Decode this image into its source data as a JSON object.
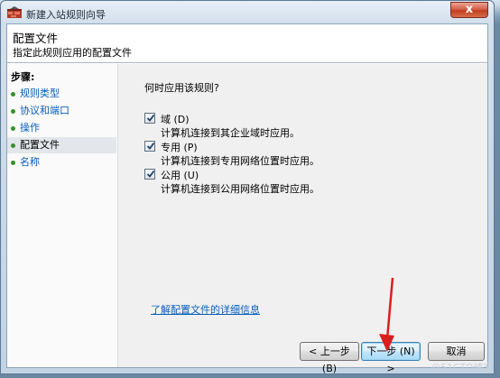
{
  "window": {
    "title": "新建入站规则向导",
    "close_label": "x"
  },
  "header": {
    "title": "配置文件",
    "subtitle": "指定此规则应用的配置文件"
  },
  "steps": {
    "title": "步骤:",
    "items": [
      {
        "label": "规则类型",
        "state": "link"
      },
      {
        "label": "协议和端口",
        "state": "link"
      },
      {
        "label": "操作",
        "state": "link"
      },
      {
        "label": "配置文件",
        "state": "current"
      },
      {
        "label": "名称",
        "state": "link"
      }
    ]
  },
  "main": {
    "question": "何时应用该规则?",
    "options": [
      {
        "label": "域 (D)",
        "description": "计算机连接到其企业域时应用。",
        "checked": true
      },
      {
        "label": "专用 (P)",
        "description": "计算机连接到专用网络位置时应用。",
        "checked": true
      },
      {
        "label": "公用 (U)",
        "description": "计算机连接到公用网络位置时应用。",
        "checked": true
      }
    ],
    "info_link": "了解配置文件的详细信息"
  },
  "buttons": {
    "back": "< 上一步 (B)",
    "next": "下一步 (N) >",
    "cancel": "取消"
  },
  "watermark": "@51CTO博客",
  "colors": {
    "link": "#0a5fb8",
    "step_dot": "#3a8e2f",
    "arrow": "#d91e1e",
    "close_button": "#c0401f"
  }
}
